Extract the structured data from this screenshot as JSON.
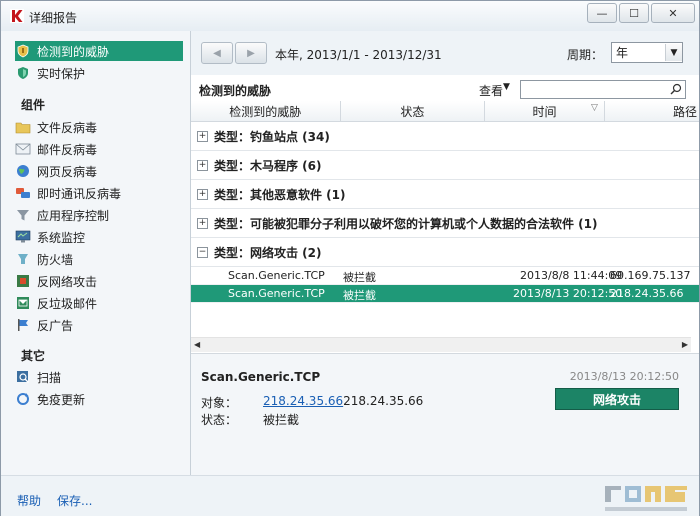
{
  "window": {
    "title": "详细报告"
  },
  "sidebar": {
    "top_items": [
      {
        "label": "检测到的威胁",
        "icon": "shield-warning-icon",
        "selected": true
      },
      {
        "label": "实时保护",
        "icon": "shield-icon",
        "selected": false
      }
    ],
    "groups": [
      {
        "label": "组件",
        "items": [
          {
            "label": "文件反病毒",
            "icon": "folder-icon"
          },
          {
            "label": "邮件反病毒",
            "icon": "mail-icon"
          },
          {
            "label": "网页反病毒",
            "icon": "globe-icon"
          },
          {
            "label": "即时通讯反病毒",
            "icon": "chat-icon"
          },
          {
            "label": "应用程序控制",
            "icon": "filter-icon"
          },
          {
            "label": "系统监控",
            "icon": "monitor-icon"
          },
          {
            "label": "防火墙",
            "icon": "firewall-icon"
          },
          {
            "label": "反网络攻击",
            "icon": "network-attack-icon"
          },
          {
            "label": "反垃圾邮件",
            "icon": "anti-spam-icon"
          },
          {
            "label": "反广告",
            "icon": "anti-banner-icon"
          }
        ]
      },
      {
        "label": "其它",
        "items": [
          {
            "label": "扫描",
            "icon": "scan-icon"
          },
          {
            "label": "免疫更新",
            "icon": "update-icon"
          }
        ]
      }
    ]
  },
  "toolbar": {
    "date_range": "本年, 2013/1/1 - 2013/12/31",
    "period_label": "周期：",
    "period_value": "年"
  },
  "section": {
    "title": "检测到的威胁",
    "view_label": "查看",
    "search_placeholder": ""
  },
  "columns": [
    "检测到的威胁",
    "状态",
    "时间",
    "路径"
  ],
  "groups": [
    {
      "label": "类型：钓鱼站点 (34)",
      "expanded": false
    },
    {
      "label": "类型：木马程序 (6)",
      "expanded": false
    },
    {
      "label": "类型：其他恶意软件 (1)",
      "expanded": false
    },
    {
      "label": "类型：可能被犯罪分子利用以破坏您的计算机或个人数据的合法软件 (1)",
      "expanded": false
    },
    {
      "label": "类型：网络攻击 (2)",
      "expanded": true
    }
  ],
  "rows": [
    {
      "threat": "Scan.Generic.TCP",
      "status": "被拦截",
      "time": "2013/8/8 11:44:09",
      "path": "60.169.75.137",
      "selected": false
    },
    {
      "threat": "Scan.Generic.TCP",
      "status": "被拦截",
      "time": "2013/8/13 20:12:50",
      "path": "218.24.35.66",
      "selected": true
    }
  ],
  "details": {
    "name": "Scan.Generic.TCP",
    "time": "2013/8/13 20:12:50",
    "object_label": "对象：",
    "object_link": "218.24.35.66",
    "object_text": "218.24.35.66",
    "status_label": "状态：",
    "status_value": "被拦截",
    "action_button": "网络攻击"
  },
  "footer": {
    "help": "帮助",
    "save": "保存..."
  },
  "colors": {
    "accent": "#1f9978",
    "button": "#1c8466",
    "link": "#1a5fb4"
  }
}
